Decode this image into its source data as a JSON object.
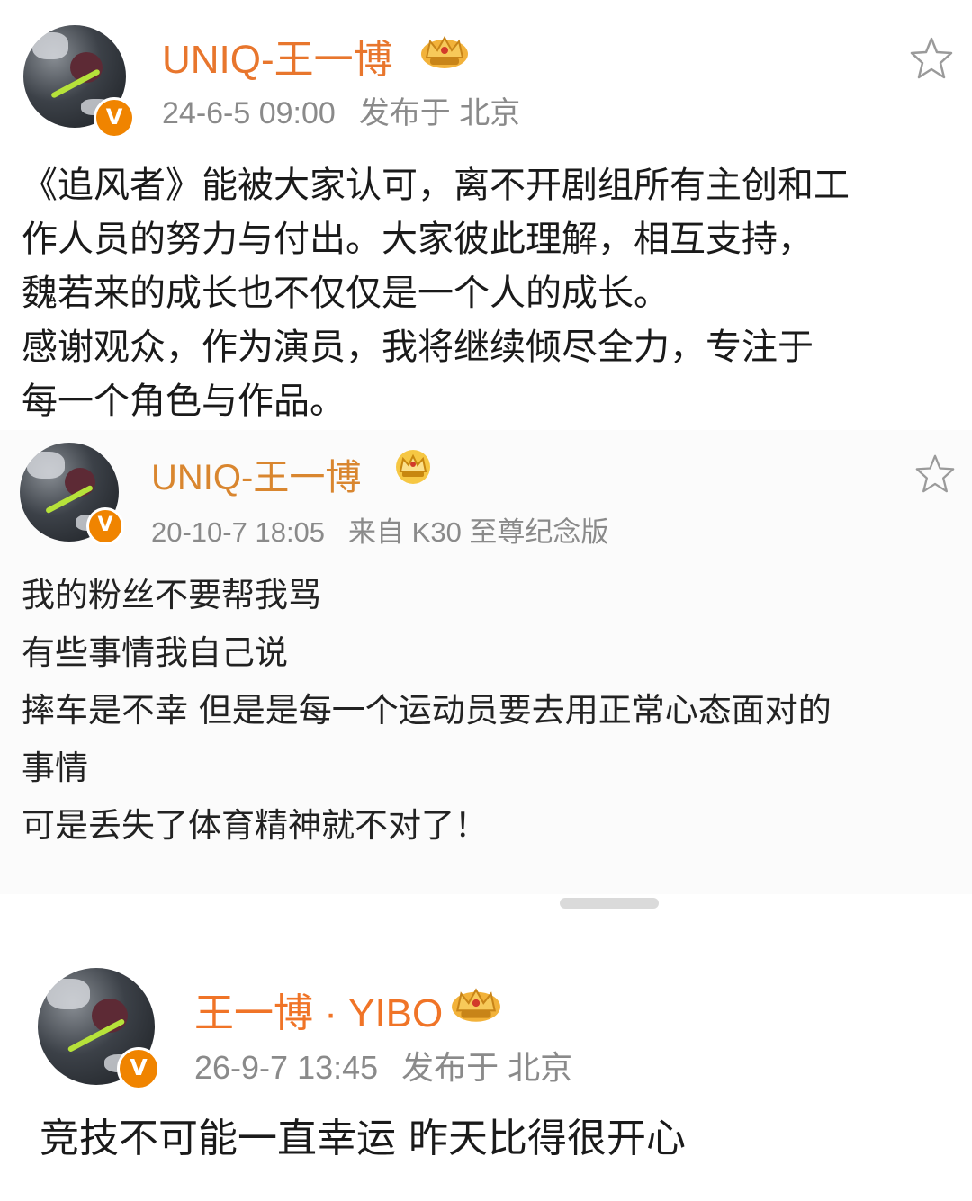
{
  "posts": [
    {
      "username": "UNIQ-王一博",
      "time": "24-6-5 09:00",
      "place": "发布于 北京",
      "lines": [
        "《追风者》能被大家认可，离不开剧组所有主创和工",
        "作人员的努力与付出。大家彼此理解，相互支持，",
        "魏若来的成长也不仅仅是一个人的成长。",
        "感谢观众，作为演员，我将继续倾尽全力，专注于",
        "每一个角色与作品。"
      ]
    },
    {
      "username": "UNIQ-王一博",
      "time": "20-10-7 18:05",
      "place": "来自 K30 至尊纪念版",
      "lines": [
        "我的粉丝不要帮我骂",
        "有些事情我自己说",
        "摔车是不幸 但是是每一个运动员要去用正常心态面对的",
        "事情",
        "可是丢失了体育精神就不对了！"
      ]
    },
    {
      "username": "王一博 · YIBO",
      "time": "26-9-7 13:45",
      "place": "发布于 北京",
      "lines": [
        "竞技不可能一直幸运 昨天比得很开心"
      ]
    }
  ],
  "icons": {
    "verified": "V",
    "crown": "crown-badge-icon",
    "star": "star-outline-icon"
  },
  "colors": {
    "username": "#e8762d",
    "meta": "#8a8a8a",
    "verified": "#f08400",
    "crown": "#f2b23a"
  }
}
